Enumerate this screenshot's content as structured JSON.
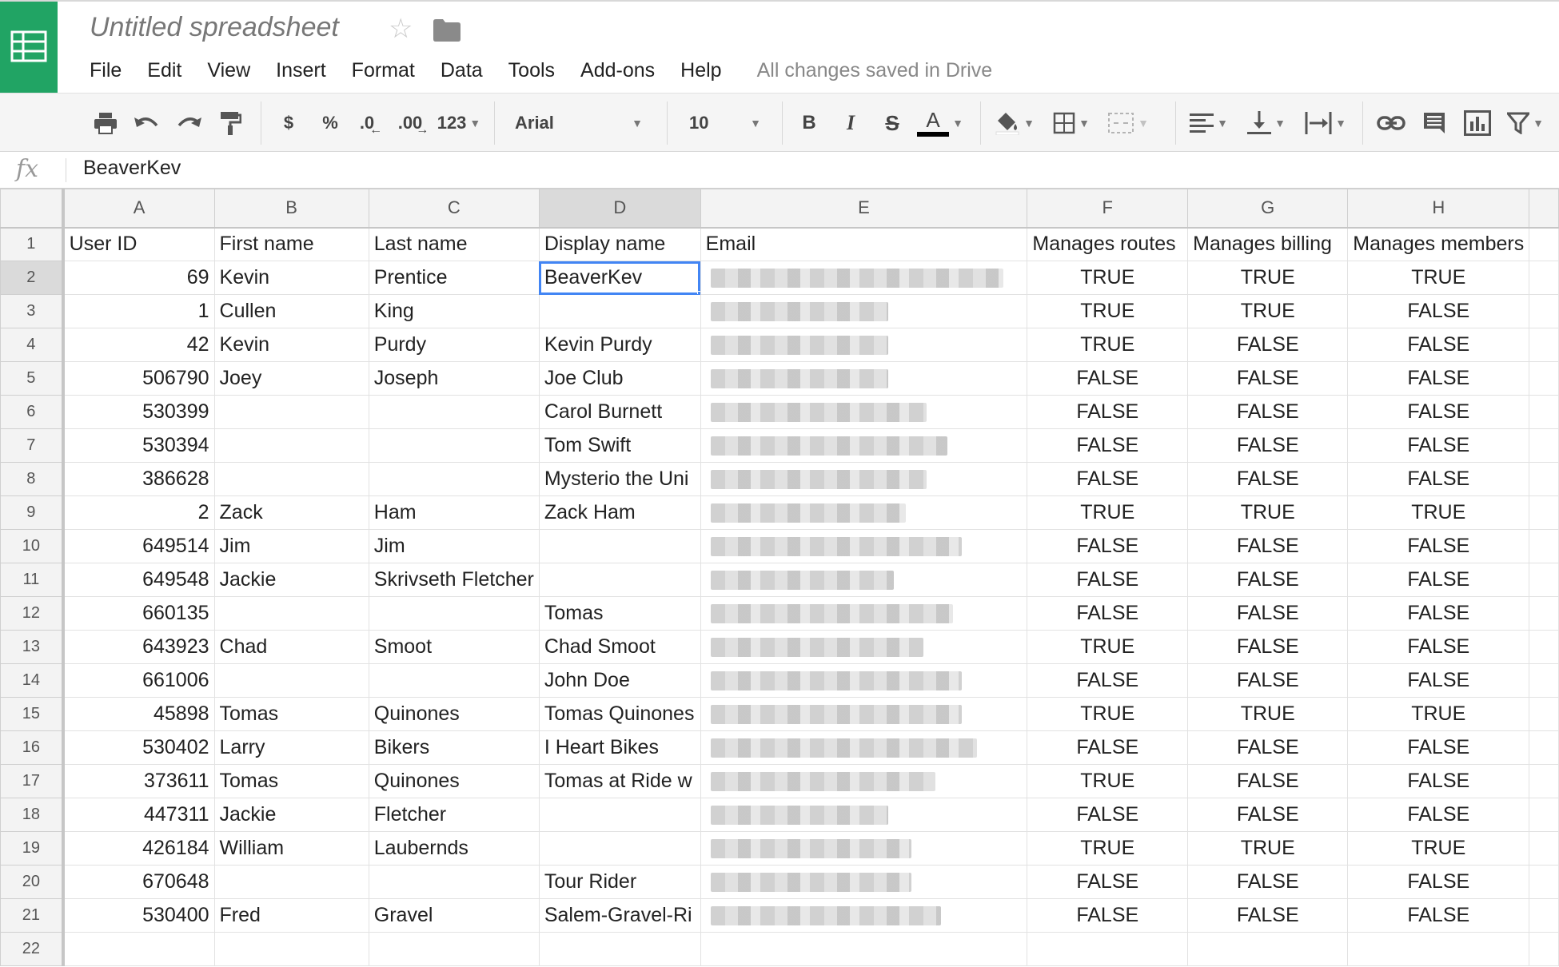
{
  "app": {
    "title": "Untitled spreadsheet",
    "save_status": "All changes saved in Drive",
    "brand_color": "#21a464"
  },
  "menu": [
    "File",
    "Edit",
    "View",
    "Insert",
    "Format",
    "Data",
    "Tools",
    "Add-ons",
    "Help"
  ],
  "toolbar": {
    "currency_label": "$",
    "percent_label": "%",
    "decrease_decimal_label": ".0",
    "increase_decimal_label": ".00",
    "more_formats_label": "123",
    "font_family": "Arial",
    "font_size": "10",
    "bold_label": "B",
    "italic_label": "I",
    "strike_label": "S",
    "text_color_label": "A"
  },
  "formula_bar": {
    "fx_label": "fx",
    "value": "BeaverKev"
  },
  "grid": {
    "columns": [
      "A",
      "B",
      "C",
      "D",
      "E",
      "F",
      "G",
      "H"
    ],
    "selected_cell": "D2",
    "header_row": [
      "User ID",
      "First name",
      "Last name",
      "Display name",
      "Email",
      "Manages routes",
      "Manages billing",
      "Manages members"
    ],
    "rows": [
      {
        "n": "2",
        "id": "69",
        "first": "Kevin",
        "last": "Prentice",
        "display": "BeaverKev",
        "routes": "TRUE",
        "billing": "TRUE",
        "members": "TRUE",
        "email_blur": 0.99
      },
      {
        "n": "3",
        "id": "1",
        "first": "Cullen",
        "last": "King",
        "display": "",
        "routes": "TRUE",
        "billing": "TRUE",
        "members": "FALSE",
        "email_blur": 0.6
      },
      {
        "n": "4",
        "id": "42",
        "first": "Kevin",
        "last": "Purdy",
        "display": "Kevin Purdy",
        "routes": "TRUE",
        "billing": "FALSE",
        "members": "FALSE",
        "email_blur": 0.6
      },
      {
        "n": "5",
        "id": "506790",
        "first": "Joey",
        "last": "Joseph",
        "display": "Joe Club",
        "routes": "FALSE",
        "billing": "FALSE",
        "members": "FALSE",
        "email_blur": 0.6
      },
      {
        "n": "6",
        "id": "530399",
        "first": "",
        "last": "",
        "display": "Carol Burnett",
        "routes": "FALSE",
        "billing": "FALSE",
        "members": "FALSE",
        "email_blur": 0.73
      },
      {
        "n": "7",
        "id": "530394",
        "first": "",
        "last": "",
        "display": "Tom Swift",
        "routes": "FALSE",
        "billing": "FALSE",
        "members": "FALSE",
        "email_blur": 0.8
      },
      {
        "n": "8",
        "id": "386628",
        "first": "",
        "last": "",
        "display": "Mysterio the Uni",
        "routes": "FALSE",
        "billing": "FALSE",
        "members": "FALSE",
        "email_blur": 0.73
      },
      {
        "n": "9",
        "id": "2",
        "first": "Zack",
        "last": "Ham",
        "display": "Zack Ham",
        "routes": "TRUE",
        "billing": "TRUE",
        "members": "TRUE",
        "email_blur": 0.66
      },
      {
        "n": "10",
        "id": "649514",
        "first": "Jim",
        "last": "Jim",
        "display": "",
        "routes": "FALSE",
        "billing": "FALSE",
        "members": "FALSE",
        "email_blur": 0.85
      },
      {
        "n": "11",
        "id": "649548",
        "first": "Jackie",
        "last": "Skrivseth Fletcher",
        "display": "",
        "routes": "FALSE",
        "billing": "FALSE",
        "members": "FALSE",
        "email_blur": 0.62
      },
      {
        "n": "12",
        "id": "660135",
        "first": "",
        "last": "",
        "display": "Tomas",
        "routes": "FALSE",
        "billing": "FALSE",
        "members": "FALSE",
        "email_blur": 0.82
      },
      {
        "n": "13",
        "id": "643923",
        "first": "Chad",
        "last": "Smoot",
        "display": "Chad Smoot",
        "routes": "TRUE",
        "billing": "FALSE",
        "members": "FALSE",
        "email_blur": 0.72
      },
      {
        "n": "14",
        "id": "661006",
        "first": "",
        "last": "",
        "display": "John Doe",
        "routes": "FALSE",
        "billing": "FALSE",
        "members": "FALSE",
        "email_blur": 0.85
      },
      {
        "n": "15",
        "id": "45898",
        "first": "Tomas",
        "last": "Quinones",
        "display": "Tomas Quinones",
        "routes": "TRUE",
        "billing": "TRUE",
        "members": "TRUE",
        "email_blur": 0.85
      },
      {
        "n": "16",
        "id": "530402",
        "first": "Larry",
        "last": "Bikers",
        "display": "I Heart Bikes",
        "routes": "FALSE",
        "billing": "FALSE",
        "members": "FALSE",
        "email_blur": 0.9
      },
      {
        "n": "17",
        "id": "373611",
        "first": "Tomas",
        "last": "Quinones",
        "display": "Tomas at Ride w",
        "routes": "TRUE",
        "billing": "FALSE",
        "members": "FALSE",
        "email_blur": 0.76
      },
      {
        "n": "18",
        "id": "447311",
        "first": "Jackie",
        "last": "Fletcher",
        "display": "",
        "routes": "FALSE",
        "billing": "FALSE",
        "members": "FALSE",
        "email_blur": 0.6
      },
      {
        "n": "19",
        "id": "426184",
        "first": "William",
        "last": "Laubernds",
        "display": "",
        "routes": "TRUE",
        "billing": "TRUE",
        "members": "TRUE",
        "email_blur": 0.68
      },
      {
        "n": "20",
        "id": "670648",
        "first": "",
        "last": "",
        "display": "Tour Rider",
        "routes": "FALSE",
        "billing": "FALSE",
        "members": "FALSE",
        "email_blur": 0.68
      },
      {
        "n": "21",
        "id": "530400",
        "first": "Fred",
        "last": "Gravel",
        "display": "Salem-Gravel-Ri",
        "routes": "FALSE",
        "billing": "FALSE",
        "members": "FALSE",
        "email_blur": 0.78
      },
      {
        "n": "22",
        "id": "",
        "first": "",
        "last": "",
        "display": "",
        "routes": "",
        "billing": "",
        "members": "",
        "email_blur": 0
      }
    ]
  }
}
